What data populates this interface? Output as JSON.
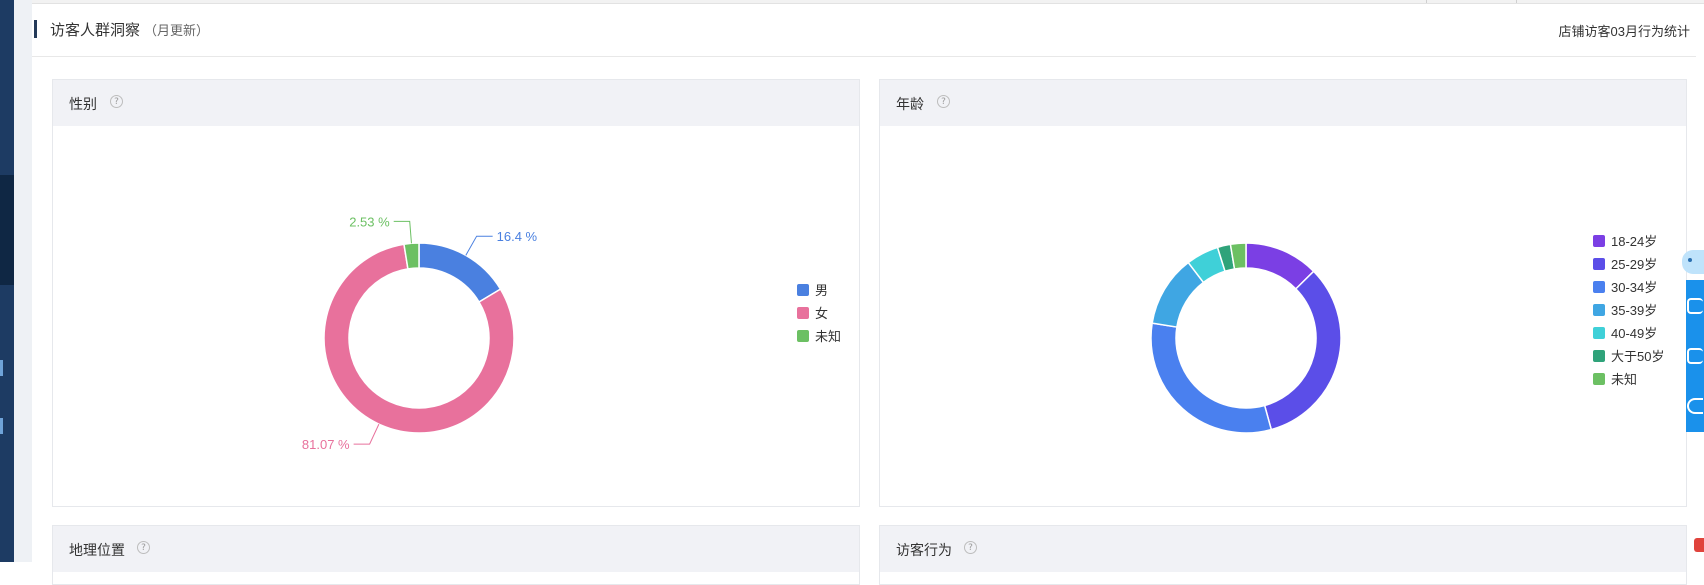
{
  "header": {
    "title": "访客人群洞察",
    "subtitle": "（月更新）",
    "right_text": "店铺访客03月行为统计"
  },
  "panels": {
    "gender": {
      "title": "性别"
    },
    "age": {
      "title": "年龄"
    },
    "geo": {
      "title": "地理位置"
    },
    "behavior": {
      "title": "访客行为"
    }
  },
  "help_glyph": "?",
  "chart_data": [
    {
      "type": "pie",
      "title": "性别",
      "categories": [
        "男",
        "女",
        "未知"
      ],
      "values": [
        16.4,
        81.07,
        2.53
      ],
      "value_labels": [
        "16.4 %",
        "81.07 %",
        "2.53 %"
      ],
      "colors": [
        "#4a80e0",
        "#e8719c",
        "#6cc063"
      ],
      "donut": true,
      "legend_position": "right"
    },
    {
      "type": "pie",
      "title": "年龄",
      "categories": [
        "18-24岁",
        "25-29岁",
        "30-34岁",
        "35-39岁",
        "40-49岁",
        "大于50岁",
        "未知"
      ],
      "values": [
        12.5,
        32.8,
        31.5,
        12.0,
        5.5,
        2.2,
        2.6
      ],
      "colors": [
        "#7b3fe4",
        "#5b4ee8",
        "#4a80ef",
        "#3fa6e3",
        "#3fd0d8",
        "#2fa37a",
        "#6cc063"
      ],
      "donut": true,
      "legend_position": "right"
    }
  ]
}
